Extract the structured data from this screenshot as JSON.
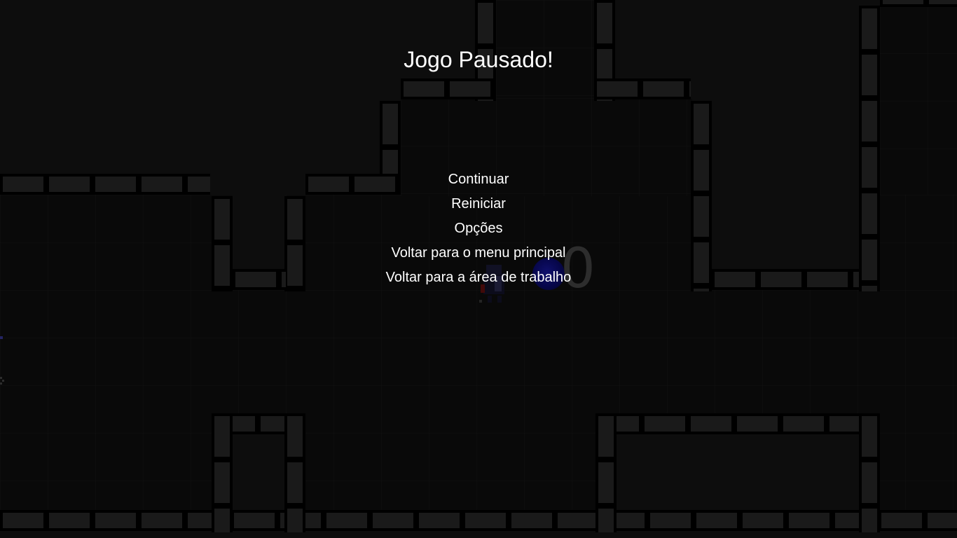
{
  "pause_screen": {
    "title": "Jogo Pausado!",
    "menu": [
      {
        "label": "Continuar"
      },
      {
        "label": "Reiniciar"
      },
      {
        "label": "Opções"
      },
      {
        "label": "Voltar para o menu principal"
      },
      {
        "label": "Voltar para a área de trabalho"
      }
    ]
  },
  "hud": {
    "counter": "0"
  },
  "colors": {
    "text": "#ffffff",
    "floor": "#0f0f0f",
    "wall": "#2a2a2a",
    "void": "#151515",
    "orb": "#1a1ab0"
  }
}
